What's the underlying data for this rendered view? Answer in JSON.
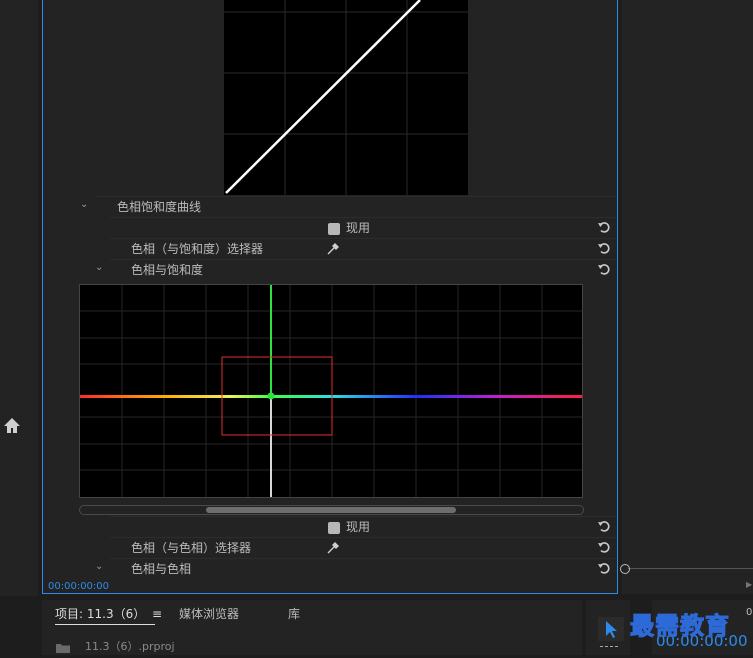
{
  "effect_controls": {
    "hue_sat_curve_label": "色相饱和度曲线",
    "enable_label_1": "现用",
    "hue_sat_selector_label": "色相（与饱和度）选择器",
    "hue_vs_sat_label": "色相与饱和度",
    "enable_label_2": "现用",
    "hue_hue_selector_label": "色相（与色相）选择器",
    "hue_vs_hue_label": "色相与色相",
    "timecode": "00:00:00:00"
  },
  "bottom_panel": {
    "tab_project": "项目: 11.3（6）",
    "tab_media_browser": "媒体浏览器",
    "tab_library": "库",
    "project_file": "11.3（6）.prproj"
  },
  "right_panel": {
    "timecode_big": "00:00:00:00",
    "timecode_small_partial": "0"
  },
  "watermark": "最需教育",
  "colors": {
    "accent": "#2d8ceb",
    "panel_bg": "#232323",
    "graph_bg": "#000000",
    "selection_box": "#e0312c"
  }
}
